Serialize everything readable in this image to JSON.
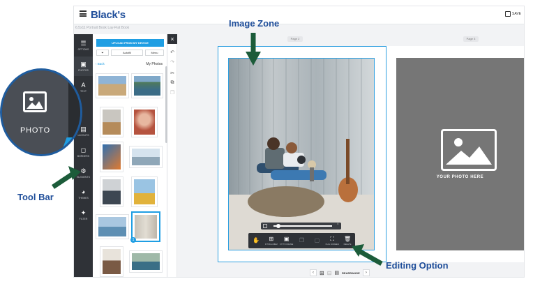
{
  "app": {
    "brand": "Black's",
    "subtitle": "6.5x11 Portrait Book Lay-Flat Book",
    "save_label": "SAVE"
  },
  "rail": [
    {
      "name": "options",
      "label": "OPTIONS",
      "icon": "sliders-icon"
    },
    {
      "name": "photos",
      "label": "PHOTOS",
      "icon": "image-icon"
    },
    {
      "name": "text",
      "label": "TEXT",
      "icon": "text-icon"
    },
    {
      "name": "layouts",
      "label": "LAYOUTS",
      "icon": "layout-icon"
    },
    {
      "name": "borders",
      "label": "BORDERS",
      "icon": "crop-icon"
    },
    {
      "name": "elements",
      "label": "ELEMENTS",
      "icon": "gear-icon"
    },
    {
      "name": "themes",
      "label": "THEMES",
      "icon": "palette-icon"
    },
    {
      "name": "filter",
      "label": "FILTER",
      "icon": "sparkle-icon"
    }
  ],
  "panel": {
    "upload_label": "UPLOAD FROM MY DEVICE",
    "filter_value": "▾",
    "autofill_label": "Autofill",
    "menu_label": "Menu",
    "back_label": "‹ Back",
    "title": "My Photos"
  },
  "canvas": {
    "page_labels": [
      "Page 2",
      "Page 3"
    ],
    "placeholder_text": "YOUR PHOTO HERE"
  },
  "edit_tools": [
    {
      "label": "",
      "icon": "move-icon",
      "dim": true
    },
    {
      "label": "FIT/FILL/MEM",
      "icon": "fit-icon",
      "dim": false
    },
    {
      "label": "FIT TO FRAME",
      "icon": "frame-icon",
      "dim": false
    },
    {
      "label": "",
      "icon": "copy-icon",
      "dim": true
    },
    {
      "label": "",
      "icon": "duplicate-icon",
      "dim": true
    },
    {
      "label": "FULL SCREEN",
      "icon": "expand-icon",
      "dim": false
    },
    {
      "label": "DELETE",
      "icon": "trash-icon",
      "dim": false
    }
  ],
  "pager": {
    "rearrange_label": "REARRANGE"
  },
  "zoom_callout": {
    "label": "PHOTO"
  },
  "annotations": {
    "image_zone": "Image Zone",
    "tool_bar": "Tool Bar",
    "editing_option": "Editing Option"
  },
  "colors": {
    "accent": "#1f9ee3",
    "brand": "#1f4e9a",
    "rail": "#2f3237",
    "annotation": "#1f4e9a",
    "arrow": "#1c5c3a"
  }
}
